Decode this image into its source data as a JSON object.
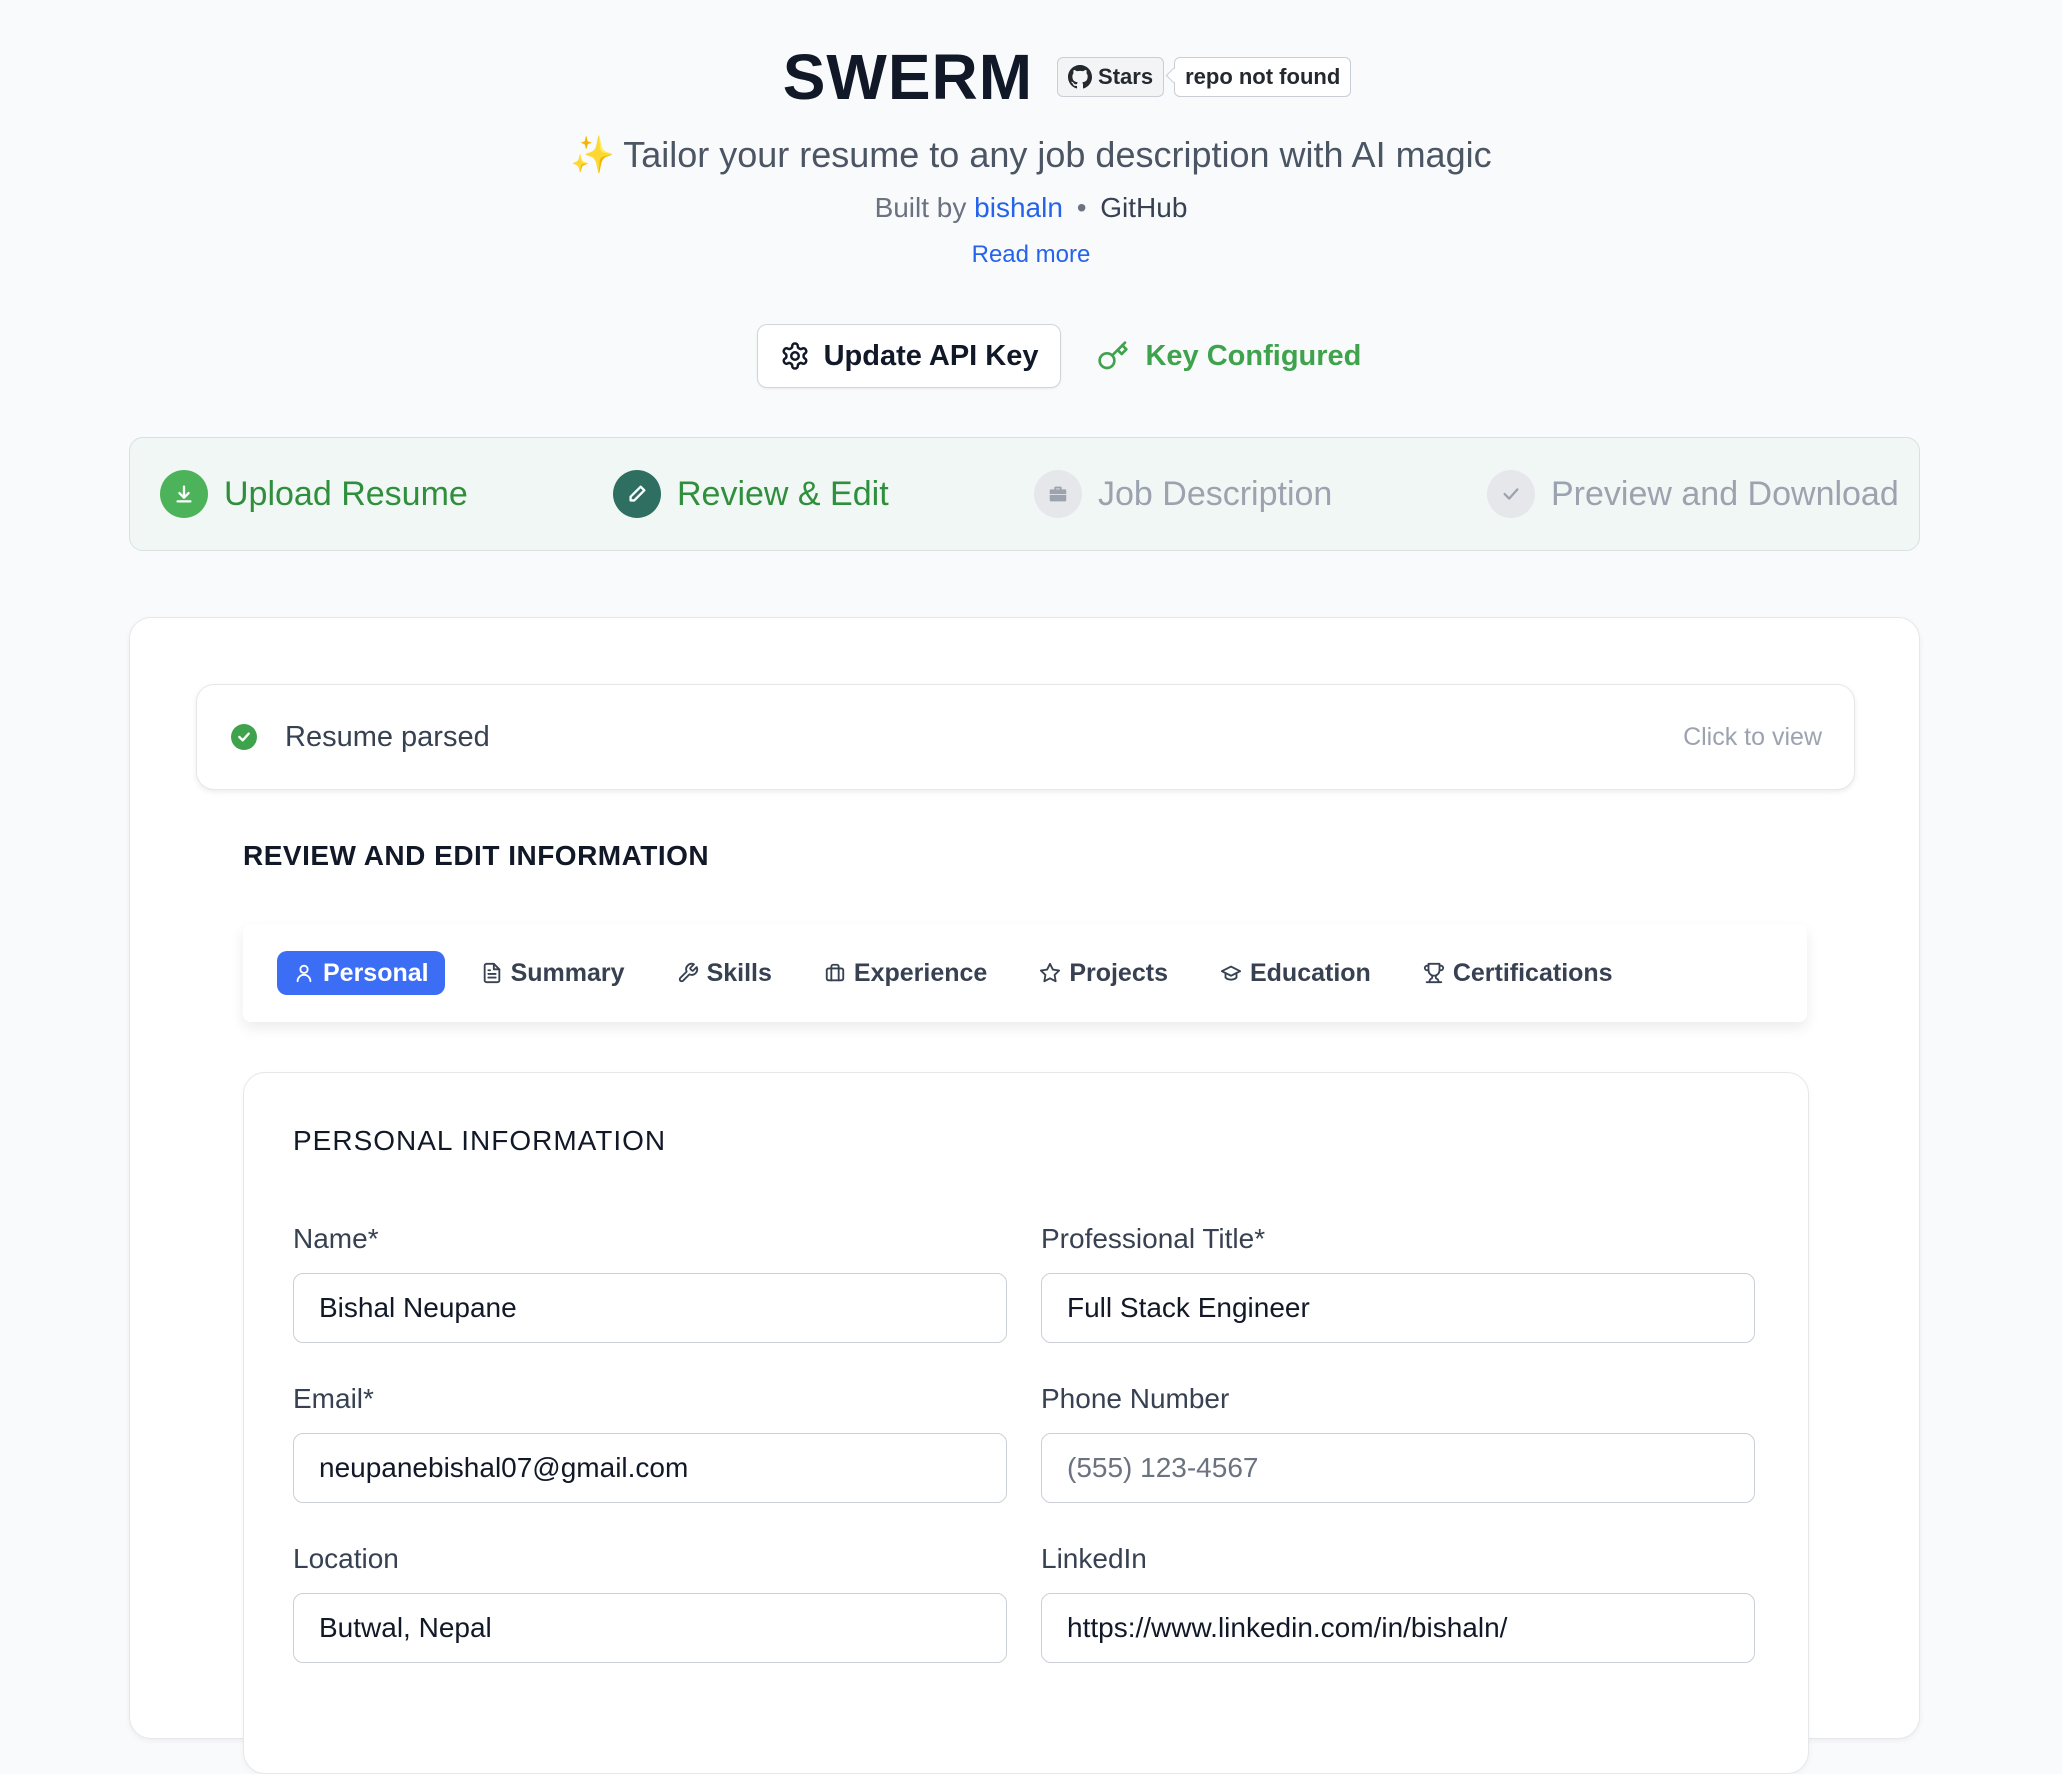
{
  "header": {
    "title": "SWERM",
    "github_button": "Stars",
    "github_count": "repo not found",
    "tagline_sparkle": "✨",
    "tagline": "Tailor your resume to any job description with AI magic",
    "built_by_prefix": "Built by",
    "author": "bishaln",
    "separator": "•",
    "github_link": "GitHub",
    "read_more": "Read more"
  },
  "api": {
    "update_label": "Update API Key",
    "status_label": "Key Configured",
    "status_color": "#3fa34d"
  },
  "steps": [
    {
      "label": "Upload Resume",
      "state": "done",
      "icon": "download-icon"
    },
    {
      "label": "Review & Edit",
      "state": "active",
      "icon": "pencil-icon"
    },
    {
      "label": "Job Description",
      "state": "pending",
      "icon": "briefcase-icon"
    },
    {
      "label": "Preview and Download",
      "state": "pending",
      "icon": "check-icon"
    }
  ],
  "parsed": {
    "label": "Resume parsed",
    "action": "Click to view"
  },
  "review": {
    "title": "REVIEW AND EDIT INFORMATION"
  },
  "tabs": [
    {
      "label": "Personal",
      "icon": "user-icon",
      "active": true
    },
    {
      "label": "Summary",
      "icon": "document-icon",
      "active": false
    },
    {
      "label": "Skills",
      "icon": "wrench-icon",
      "active": false
    },
    {
      "label": "Experience",
      "icon": "briefcase-icon",
      "active": false
    },
    {
      "label": "Projects",
      "icon": "star-icon",
      "active": false
    },
    {
      "label": "Education",
      "icon": "graduation-cap-icon",
      "active": false
    },
    {
      "label": "Certifications",
      "icon": "trophy-icon",
      "active": false
    }
  ],
  "personal": {
    "title": "PERSONAL INFORMATION",
    "name_label": "Name*",
    "name_value": "Bishal Neupane",
    "title_label": "Professional Title*",
    "title_value": "Full Stack Engineer",
    "email_label": "Email*",
    "email_value": "neupanebishal07@gmail.com",
    "phone_label": "Phone Number",
    "phone_value": "",
    "phone_placeholder": "(555) 123-4567",
    "location_label": "Location",
    "location_value": "Butwal, Nepal",
    "linkedin_label": "LinkedIn",
    "linkedin_value": "https://www.linkedin.com/in/bishaln/"
  },
  "colors": {
    "accent": "#3b6ef5",
    "success": "#3fa34d",
    "step_active": "#2e6f62"
  }
}
